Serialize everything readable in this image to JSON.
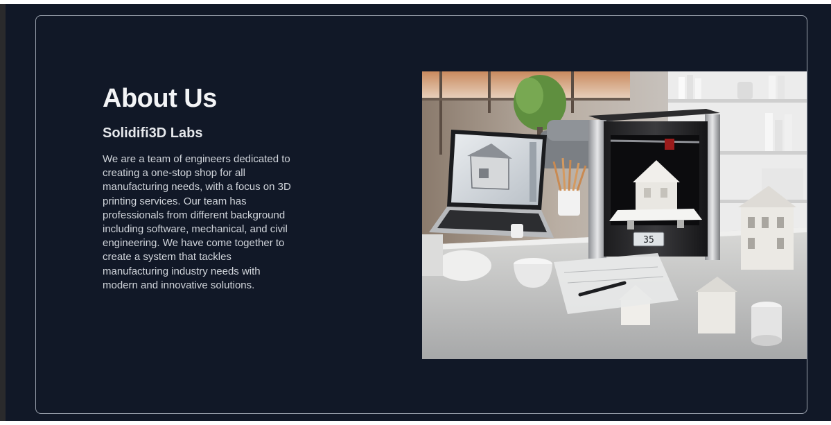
{
  "about": {
    "title": "About Us",
    "company": "Solidifi3D Labs",
    "description": "We are a team of engineers dedicated to creating a one-stop shop for all manufacturing needs, with a focus on 3D printing services. Our team has professionals from different background including software, mechanical, and civil engineering. We have come together to create a system that tackles manufacturing industry needs with modern and innovative solutions."
  },
  "hero_image": {
    "printer_display": "35"
  },
  "colors": {
    "page_background": "#111827",
    "card_border": "#9ca3af",
    "heading": "#f3f4f6",
    "body_text": "#d1d5db"
  }
}
